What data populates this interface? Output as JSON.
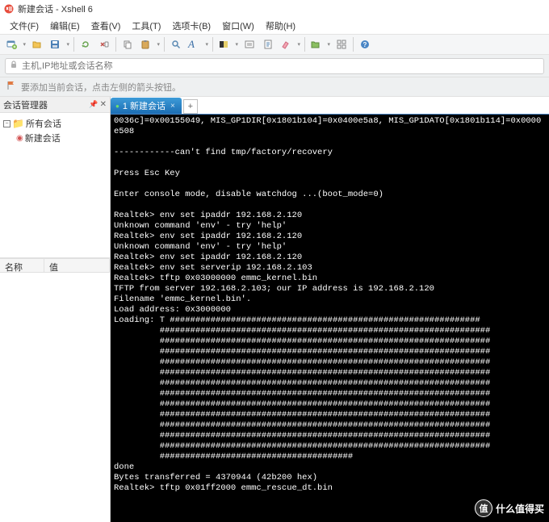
{
  "title": "新建会话 - Xshell 6",
  "menu": {
    "file": "文件(F)",
    "edit": "编辑(E)",
    "view": "查看(V)",
    "tools": "工具(T)",
    "tabs": "选项卡(B)",
    "window": "窗口(W)",
    "help": "帮助(H)"
  },
  "address": {
    "placeholder": "主机,IP地址或会话名称"
  },
  "hint": {
    "text": "要添加当前会话，点击左侧的箭头按钮。"
  },
  "sidebar": {
    "title": "会话管理器",
    "tree_root": "所有会话",
    "tree_child": "新建会话",
    "col_name": "名称",
    "col_value": "值"
  },
  "tab": {
    "label": "1 新建会话"
  },
  "terminal_lines": [
    "0036c]=0x00155049, MIS_GP1DIR[0x1801b104]=0x0400e5a8, MIS_GP1DATO[0x1801b114]=0x0000",
    "e508",
    "",
    "------------can't find tmp/factory/recovery",
    "",
    "Press Esc Key",
    "",
    "Enter console mode, disable watchdog ...(boot_mode=0)",
    "",
    "Realtek> env set ipaddr 192.168.2.120",
    "Unknown command 'env' - try 'help'",
    "Realtek> env set ipaddr 192.168.2.120",
    "Unknown command 'env' - try 'help'",
    "Realtek> env set ipaddr 192.168.2.120",
    "Realtek> env set serverip 192.168.2.103",
    "Realtek> tftp 0x03000000 emmc_kernel.bin",
    "TFTP from server 192.168.2.103; our IP address is 192.168.2.120",
    "Filename 'emmc_kernel.bin'.",
    "Load address: 0x3000000",
    "Loading: T #############################################################",
    "         #################################################################",
    "         #################################################################",
    "         #################################################################",
    "         #################################################################",
    "         #################################################################",
    "         #################################################################",
    "         #################################################################",
    "         #################################################################",
    "         #################################################################",
    "         #################################################################",
    "         #################################################################",
    "         #################################################################",
    "         ######################################",
    "done",
    "Bytes transferred = 4370944 (42b200 hex)",
    "Realtek> tftp 0x01ff2000 emmc_rescue_dt.bin"
  ],
  "watermark": {
    "badge": "值",
    "text": "什么值得买"
  }
}
